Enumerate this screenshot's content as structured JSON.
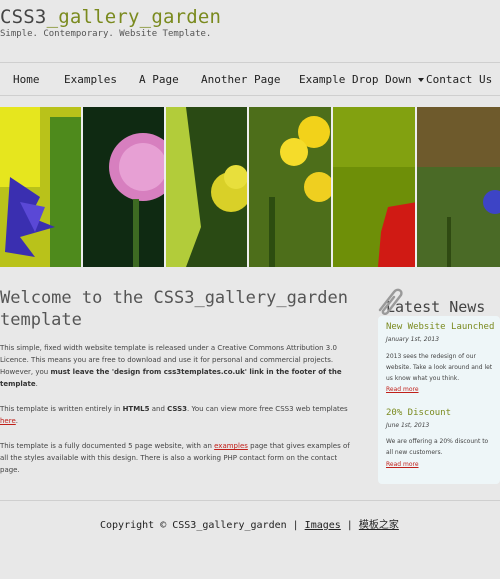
{
  "header": {
    "title_prefix": "CSS3",
    "title_accent": "_gallery_garden",
    "slogan": "Simple. Contemporary. Website Template."
  },
  "menu": [
    {
      "label": "Home"
    },
    {
      "label": "Examples"
    },
    {
      "label": "A Page"
    },
    {
      "label": "Another Page"
    },
    {
      "label": "Example Drop Down"
    },
    {
      "label": "Contact Us"
    }
  ],
  "content": {
    "heading": "Welcome to the CSS3_gallery_garden template",
    "p1_a": "This simple, fixed width website template is released under a Creative Commons Attribution 3.0 Licence. This means you are free to download and use it for personal and commercial projects. However, you ",
    "p1_b": "must leave the 'design from css3templates.co.uk' link in the footer of the template",
    "p1_c": ".",
    "p2_a": "This template is written entirely in ",
    "p2_b": "HTML5",
    "p2_c": " and ",
    "p2_d": "CSS3",
    "p2_e": ". You can view more free CSS3 web templates ",
    "p2_link": "here",
    "p2_f": ".",
    "p3_a": "This template is a fully documented 5 page website, with an ",
    "p3_link": "examples",
    "p3_b": " page that gives examples of all the styles available with this design. There is also a working PHP contact form on the contact page."
  },
  "sidebar": {
    "title": "Latest News",
    "news": [
      {
        "heading": "New Website Launched",
        "date": "January 1st, 2013",
        "text": "2013 sees the redesign of our website. Take a look around and let us know what you think.",
        "link": "Read more"
      },
      {
        "heading": "20% Discount",
        "date": "June 1st, 2013",
        "text": "We are offering a 20% discount to all new customers.",
        "link": "Read more"
      }
    ]
  },
  "footer": {
    "copyright": "Copyright © CSS3_gallery_garden",
    "images": "Images",
    "credit": "模板之家"
  },
  "colors": {
    "accent": "#7a8a1e",
    "link": "#c0201a",
    "sidebar_bg": "#eef6f8"
  }
}
